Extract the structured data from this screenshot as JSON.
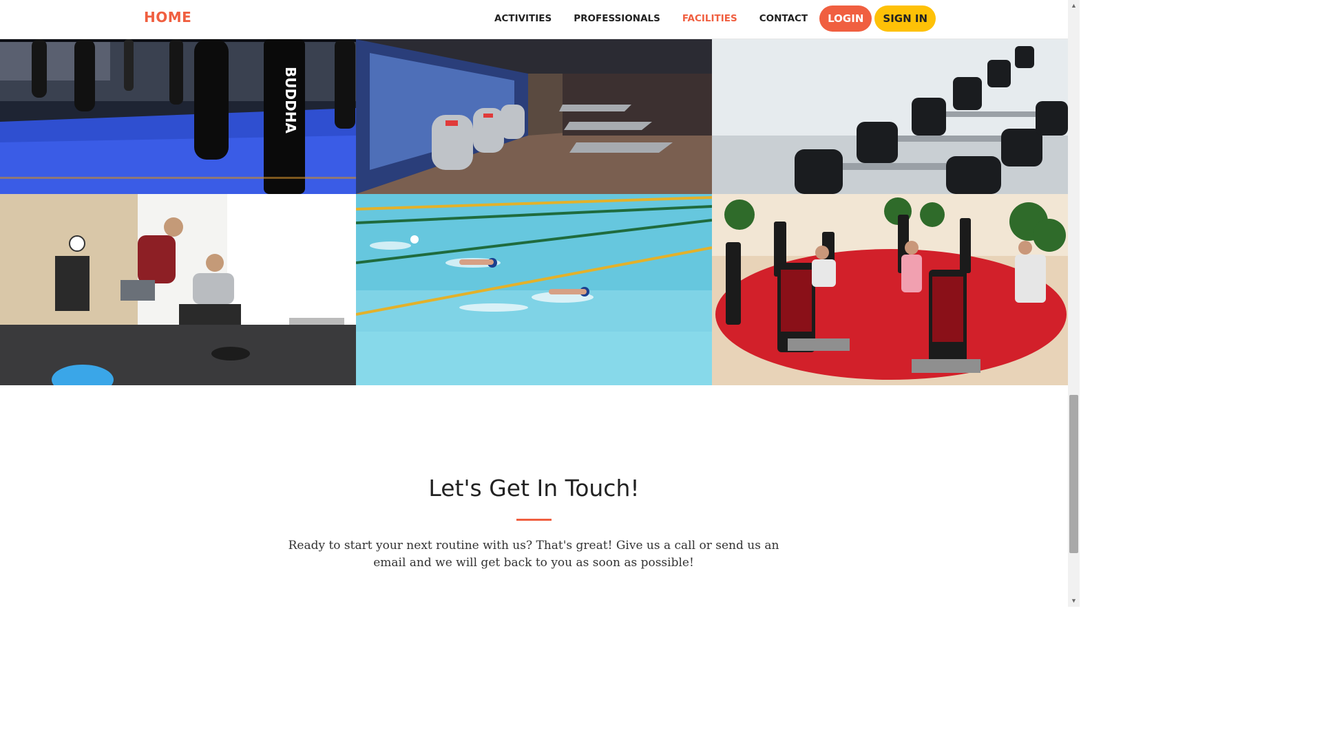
{
  "nav": {
    "brand": "HOME",
    "links": [
      "ACTIVITIES",
      "PROFESSIONALS",
      "FACILITIES",
      "CONTACT"
    ],
    "active": "FACILITIES",
    "login": "LOGIN",
    "signin": "SIGN IN"
  },
  "gallery": {
    "images": [
      "boxing-room",
      "cardio-room",
      "dumbbell-rack",
      "personal-training",
      "swimming-pool",
      "group-exercise"
    ]
  },
  "contact": {
    "title": "Let's Get In Touch!",
    "text": "Ready to start your next routine with us? That's great! Give us a call or send us an email and we will get back to you as soon as possible!"
  },
  "colors": {
    "primary": "#f05f40",
    "secondary": "#fec107"
  }
}
